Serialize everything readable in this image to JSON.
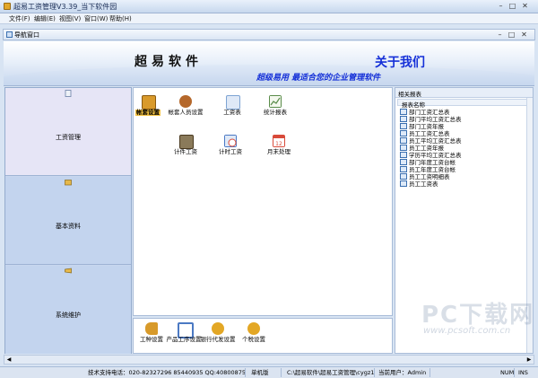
{
  "window": {
    "title": "超易工资管理V3.39_当下软件园"
  },
  "menu": [
    "文件(F)",
    "编辑(E)",
    "视图(V)",
    "窗口(W)",
    "帮助(H)"
  ],
  "nav": {
    "title": "导航窗口"
  },
  "banner": {
    "title": "超易软件",
    "about": "关于我们",
    "slogan": "超级易用  最适合您的企业管理软件"
  },
  "left_sections": [
    {
      "label": "工资管理"
    },
    {
      "label": "基本资料"
    },
    {
      "label": "系统维护"
    }
  ],
  "tiles": [
    {
      "label": "帐套设置",
      "icon": "ledger-icon",
      "color": "#d99a2b"
    },
    {
      "label": "帐套人员设置",
      "icon": "person-icon",
      "color": "#b5682b"
    },
    {
      "label": "工资表",
      "icon": "sheet-icon",
      "color": "#7ea4d3"
    },
    {
      "label": "统计报表",
      "icon": "chart-icon",
      "color": "#5a8c4a"
    },
    {
      "label": "计件工资",
      "icon": "briefcase-icon",
      "color": "#8a7a5a"
    },
    {
      "label": "计时工资",
      "icon": "clock-icon",
      "color": "#4978c4"
    },
    {
      "label": "月末处理",
      "icon": "calendar-icon",
      "color": "#d84a3a"
    }
  ],
  "bottom_tiles": [
    {
      "label": "工种设置",
      "icon": "hand-icon",
      "color": "#d89a2a"
    },
    {
      "label": "产品工序设置",
      "icon": "product-icon",
      "color": "#4b79c3"
    },
    {
      "label": "银行代发设置",
      "icon": "bank-icon",
      "color": "#e3a725"
    },
    {
      "label": "个税设置",
      "icon": "tax-icon",
      "color": "#e3a725"
    }
  ],
  "right": {
    "title": "相关报表",
    "column": "报表名称",
    "items": [
      "部门工资汇总表",
      "部门平均工资汇总表",
      "部门工资年报",
      "员工工资汇总表",
      "员工平均工资汇总表",
      "员工工资年报",
      "学历平均工资汇总表",
      "部门年度工资台帐",
      "员工年度工资台帐",
      "员工工资明细表",
      "员工工资表"
    ]
  },
  "status": {
    "support": "技术支持电话：020-82327296 85440935 QQ:408008750 1966903",
    "mode": "单机版",
    "path": "C:\\超易软件\\超易工资管理\\cygz1.sys",
    "user": "当前用户：Admin",
    "num": "NUM",
    "ins": "INS"
  },
  "watermark": {
    "big": "PC下载网",
    "small": "www.pcsoft.com.cn"
  }
}
